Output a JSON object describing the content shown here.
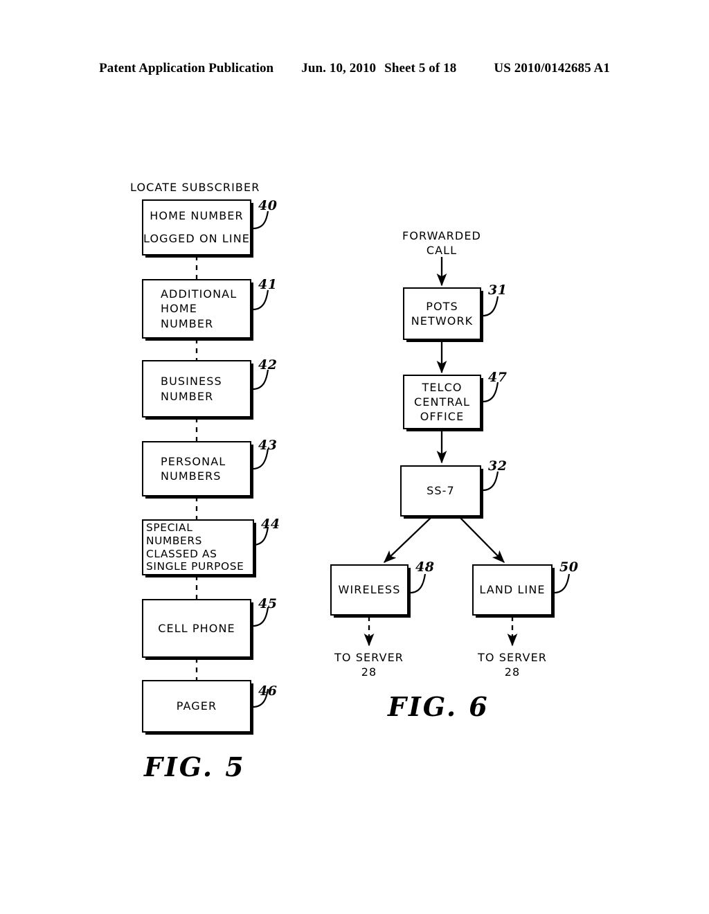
{
  "header": {
    "publication": "Patent Application Publication",
    "date": "Jun. 10, 2010",
    "sheet": "Sheet 5 of 18",
    "patent_number": "US 2010/0142685 A1"
  },
  "figures": [
    {
      "id": "fig5",
      "label": "FIG. 5",
      "title": "LOCATE SUBSCRIBER",
      "boxes": [
        {
          "ref": "40",
          "text": "HOME NUMBER\nLOGGED ON LINE"
        },
        {
          "ref": "41",
          "text": "ADDITIONAL\nHOME\nNUMBER"
        },
        {
          "ref": "42",
          "text": "BUSINESS\nNUMBER"
        },
        {
          "ref": "43",
          "text": "PERSONAL\nNUMBERS"
        },
        {
          "ref": "44",
          "text": "SPECIAL\nNUMBERS\nCLASSED AS\nSINGLE PURPOSE"
        },
        {
          "ref": "45",
          "text": "CELL PHONE"
        },
        {
          "ref": "46",
          "text": "PAGER"
        }
      ]
    },
    {
      "id": "fig6",
      "label": "FIG. 6",
      "entry_label": "FORWARDED\nCALL",
      "boxes": [
        {
          "ref": "31",
          "text": "POTS\nNETWORK"
        },
        {
          "ref": "47",
          "text": "TELCO\nCENTRAL\nOFFICE"
        },
        {
          "ref": "32",
          "text": "SS-7"
        },
        {
          "ref": "48",
          "text": "WIRELESS"
        },
        {
          "ref": "50",
          "text": "LAND LINE"
        }
      ],
      "exits": [
        {
          "text": "TO SERVER\n28"
        },
        {
          "text": "TO SERVER\n28"
        }
      ]
    }
  ],
  "colors": {
    "ink": "#000000",
    "paper": "#ffffff"
  }
}
